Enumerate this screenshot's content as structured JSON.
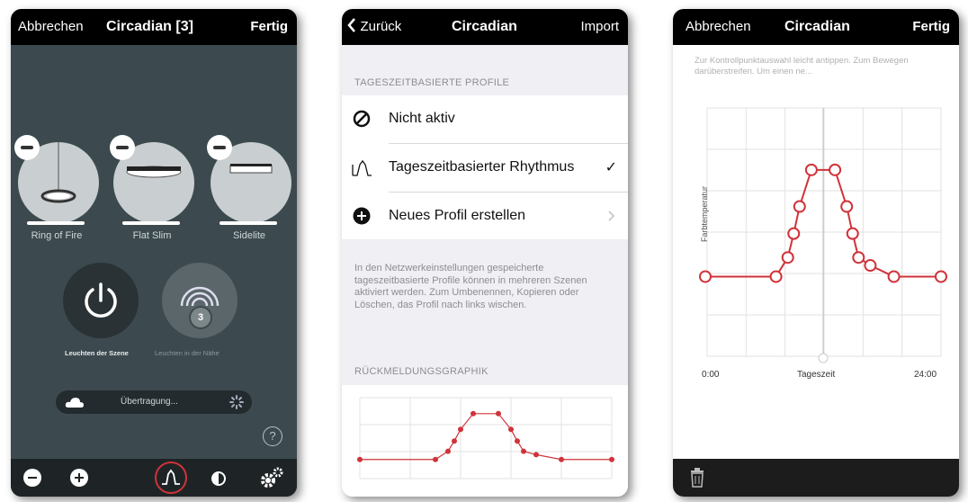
{
  "phone1": {
    "nav": {
      "left": "Abbrechen",
      "title": "Circadian [3]",
      "right": "Fertig"
    },
    "lamps": [
      {
        "label": "Ring of Fire"
      },
      {
        "label": "Flat Slim"
      },
      {
        "label": "Sidelite"
      }
    ],
    "power_label": "Leuchten der Szene",
    "nearby_label": "Leuchten in der Nähe",
    "nearby_count": "3",
    "transfer_text": "Übertragung...",
    "help": "?",
    "colors": {
      "bg": "#3c4a4f",
      "highlight": "#d0333a"
    },
    "toolbar_icons": [
      "minus-icon",
      "plus-icon",
      "curve-icon",
      "brightness-icon",
      "settings-icon"
    ]
  },
  "phone2": {
    "nav": {
      "back": "Zurück",
      "title": "Circadian",
      "right": "Import"
    },
    "section1": "TAGESZEITBASIERTE PROFILE",
    "items": [
      {
        "label": "Nicht aktiv"
      },
      {
        "label": "Tageszeitbasierter Rhythmus",
        "check": "✓"
      },
      {
        "label": "Neues Profil erstellen"
      }
    ],
    "footnote": "In den Netzwerkeinstellungen gespeicherte tageszeitbasierte Profile können in mehreren Szenen aktiviert werden. Zum Umbenennen, Kopieren oder Löschen, das Profil nach links wischen.",
    "section2": "RÜCKMELDUNGSGRAPHIK"
  },
  "phone3": {
    "nav": {
      "left": "Abbrechen",
      "title": "Circadian",
      "right": "Fertig"
    },
    "hint": "Zur Kontrollpunktauswahl leicht antippen. Zum Bewegen darüberstreifen. Um einen ne...",
    "ylabel": "Farbtemperatur",
    "xlabel": "Tageszeit",
    "xstart": "0:00",
    "xend": "24:00"
  },
  "chart_data": {
    "type": "line",
    "xlabel": "Tageszeit",
    "ylabel": "Farbtemperatur",
    "x_ticks": [
      "0:00",
      "24:00"
    ],
    "grid": true,
    "x": [
      0,
      6,
      7,
      7.5,
      8,
      9,
      11,
      12,
      12.5,
      13,
      14,
      16,
      20
    ],
    "y": [
      0.28,
      0.28,
      0.4,
      0.55,
      0.72,
      0.95,
      0.95,
      0.72,
      0.55,
      0.4,
      0.35,
      0.28,
      0.28
    ]
  }
}
